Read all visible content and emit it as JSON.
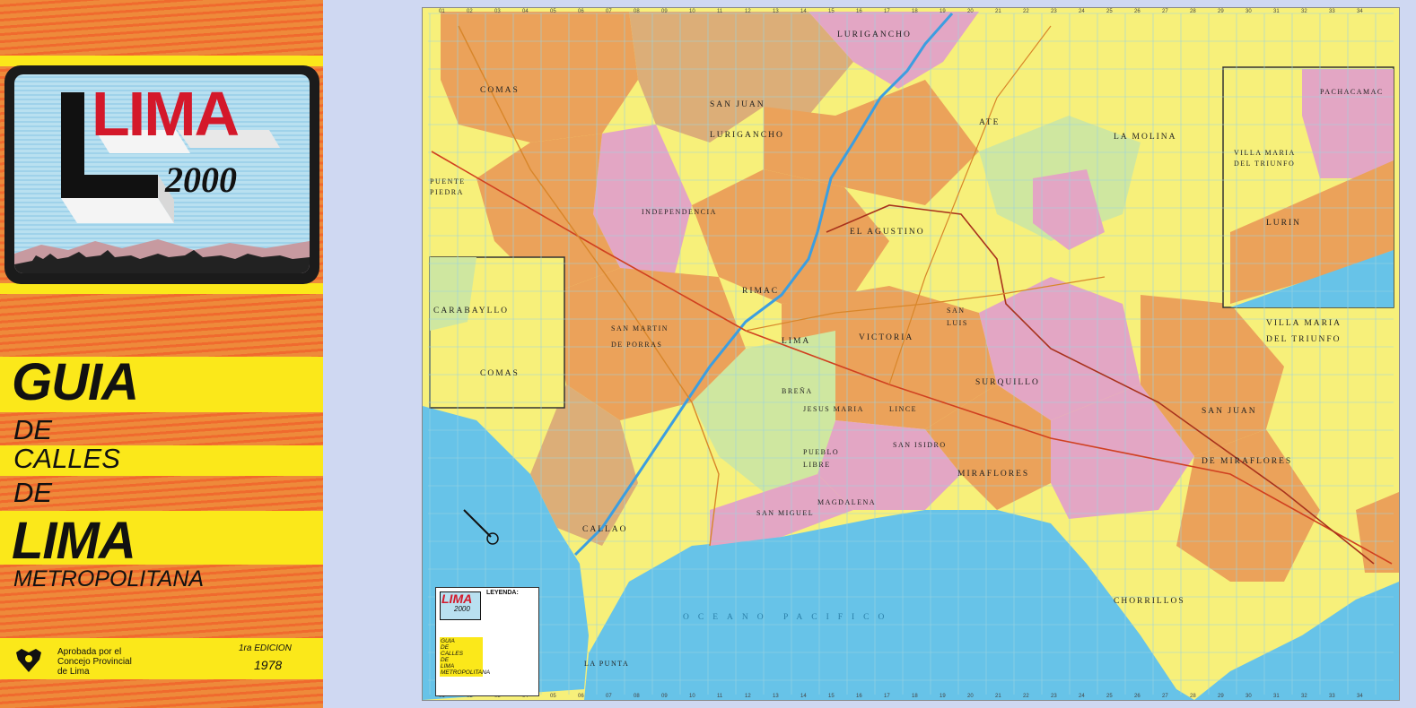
{
  "cover": {
    "logo_word": "LIMA",
    "logo_year": "2000",
    "line1": "GUIA",
    "line2": "DE",
    "line3": "CALLES",
    "line4": "DE",
    "line5": "LIMA",
    "line6": "METROPOLITANA",
    "approval_1": "Aprobada por el",
    "approval_2": "Concejo Provincial",
    "approval_3": "de Lima",
    "edition_label": "1ra EDICION",
    "edition_year": "1978"
  },
  "map": {
    "colors": {
      "ocean": "#67c3e8",
      "yellow": "#f7f07a",
      "orange": "#eba25a",
      "tan": "#dcae78",
      "pink": "#e3a6c4",
      "green": "#cfe7a0",
      "river": "#3c9ee0",
      "grid": "#9bd3e0"
    },
    "places": {
      "lurigancho_top": "LURIGANCHO",
      "comas": "COMAS",
      "san_juan_lurigancho_1": "SAN JUAN",
      "san_juan_lurigancho_2": "LURIGANCHO",
      "ate": "ATE",
      "la_molina": "LA MOLINA",
      "puente_piedra_1": "PUENTE",
      "puente_piedra_2": "PIEDRA",
      "independencia": "INDEPENDENCIA",
      "el_agustino": "EL AGUSTINO",
      "carabayllo": "CARABAYLLO",
      "comas_inset": "COMAS",
      "san_martin_1": "SAN MARTIN",
      "san_martin_2": "DE PORRAS",
      "rimac": "RIMAC",
      "lima": "LIMA",
      "victoria": "VICTORIA",
      "san_luis_1": "SAN",
      "san_luis_2": "LUIS",
      "surquillo": "SURQUILLO",
      "jesus_maria": "JESUS MARIA",
      "brena": "BREÑA",
      "pueblo_libre_1": "PUEBLO",
      "pueblo_libre_2": "LIBRE",
      "lince": "LINCE",
      "magdalena": "MAGDALENA",
      "san_miguel": "SAN MIGUEL",
      "callao": "CALLAO",
      "miraflores": "MIRAFLORES",
      "san_isidro": "SAN ISIDRO",
      "pachacamac": "PACHACAMAC",
      "villa_maria_inset_1": "VILLA MARIA",
      "villa_maria_inset_2": "DEL TRIUNFO",
      "lurin": "LURIN",
      "villa_maria_1": "VILLA MARIA",
      "villa_maria_2": "DEL TRIUNFO",
      "san_juan_miraflores_1": "SAN JUAN",
      "san_juan_miraflores_2": "DE MIRAFLORES",
      "chorrillos": "CHORRILLOS",
      "la_punta": "LA PUNTA",
      "ocean": "OCEANO PACIFICO"
    },
    "legend": {
      "title": "LEYENDA:",
      "logo": "LIMA",
      "year": "2000",
      "lines": [
        "GUIA",
        "DE",
        "CALLES",
        "DE",
        "LIMA",
        "METROPOLITANA"
      ]
    },
    "grid_columns": [
      "01",
      "02",
      "03",
      "04",
      "05",
      "06",
      "07",
      "08",
      "09",
      "10",
      "11",
      "12",
      "13",
      "14",
      "15",
      "16",
      "17",
      "18",
      "19",
      "20",
      "21",
      "22",
      "23",
      "24",
      "25",
      "26",
      "27",
      "28",
      "29",
      "30",
      "31",
      "32",
      "33",
      "34"
    ]
  }
}
